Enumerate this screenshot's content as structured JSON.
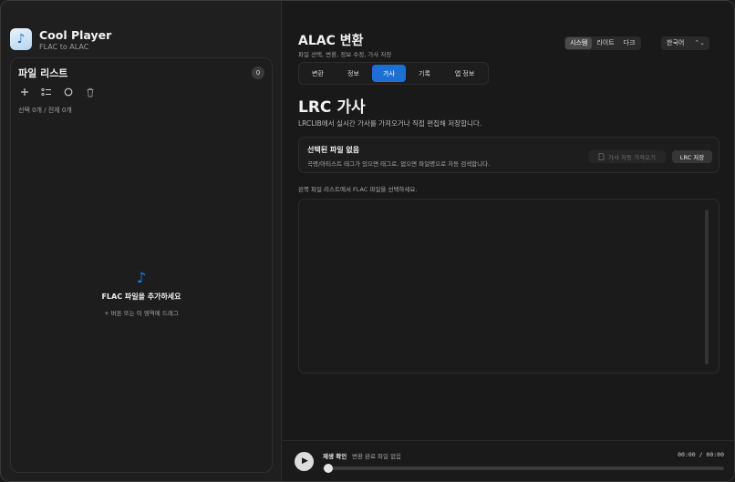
{
  "app": {
    "title": "Cool Player",
    "subtitle": "FLAC to ALAC",
    "icon": "music-note-icon"
  },
  "sidebar": {
    "title": "파일 리스트",
    "count": "0",
    "tools": [
      {
        "name": "add-file-icon",
        "glyph": "+"
      },
      {
        "name": "select-list-icon",
        "glyph": "☰"
      },
      {
        "name": "circle-icon",
        "glyph": "○"
      },
      {
        "name": "trash-icon",
        "glyph": "🗑"
      }
    ],
    "selection_info": "선택 0개 / 전체 0개",
    "empty_title": "FLAC 파일을 추가하세요",
    "empty_hint": "+ 버튼 또는 이 영역에 드래그"
  },
  "main": {
    "title": "ALAC 변환",
    "subtitle": "파일 선택, 변환, 정보 수정, 가사 저장",
    "theme": {
      "options": [
        "시스템",
        "라이트",
        "다크"
      ],
      "selected": "시스템"
    },
    "language": {
      "selected": "한국어"
    },
    "tabs": [
      "변환",
      "정보",
      "가사",
      "기록",
      "앱 정보"
    ],
    "active_tab": "가사",
    "section_title": "LRC 가사",
    "section_desc": "LRCLIB에서 실시간 가사를 가져오거나 직접 편집해 저장합니다.",
    "card": {
      "title": "선택된 파일 없음",
      "desc": "곡명/아티스트 태그가 있으면 태그로, 없으면 파일명으로 자동 검색합니다.",
      "fetch_label": "가사 자동 가져오기",
      "save_label": "LRC 저장"
    },
    "hint": "왼쪽 파일 리스트에서 FLAC 파일을 선택하세요."
  },
  "player": {
    "label": "재생 확인",
    "status": "변환 완료 파일 없음",
    "time": "00:00 / 00:00",
    "progress": 0
  },
  "colors": {
    "accent": "#1e6fd4",
    "note": "#1f84e6"
  }
}
